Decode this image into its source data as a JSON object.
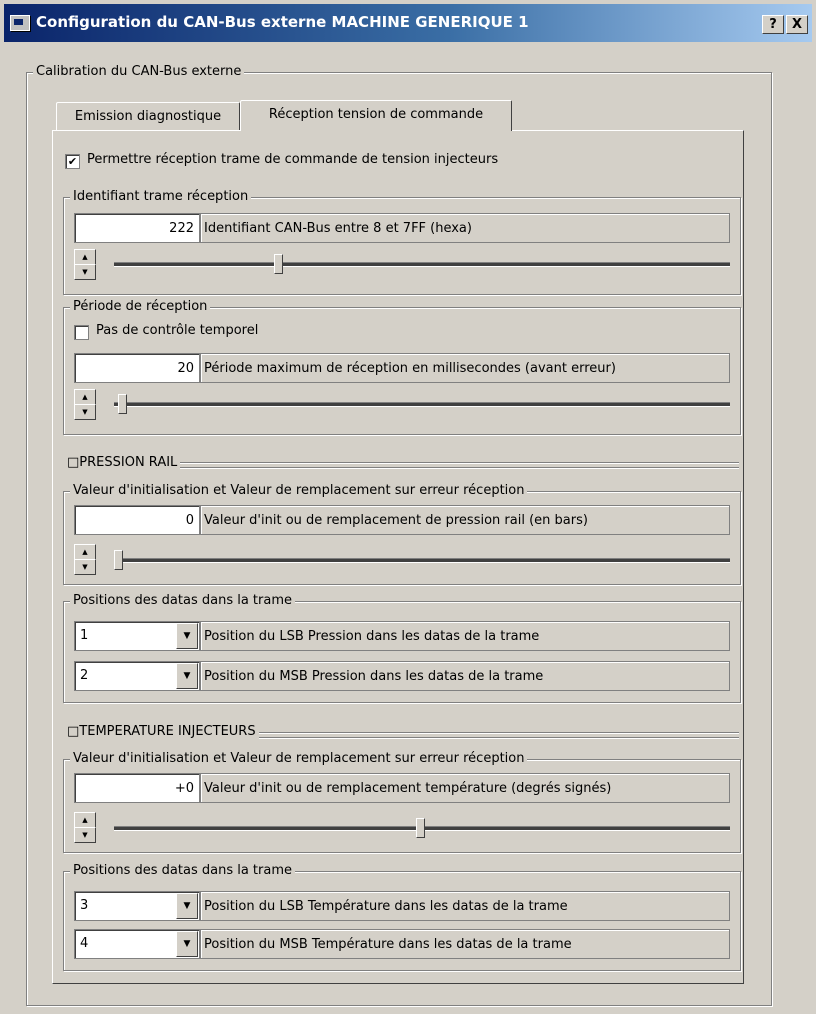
{
  "window": {
    "title": "Configuration du CAN-Bus externe MACHINE GENERIQUE 1",
    "help_label": "?",
    "close_label": "X"
  },
  "calibration": {
    "legend": "Calibration du CAN-Bus externe",
    "tabs": [
      {
        "label": "Emission diagnostique",
        "active": false
      },
      {
        "label": "Réception tension de commande",
        "active": true
      }
    ]
  },
  "reception": {
    "enable_label": "Permettre réception trame de commande de tension injecteurs",
    "enable_checked": true,
    "identifiant": {
      "legend": "Identifiant trame réception",
      "value": "222",
      "description": "Identifiant CAN-Bus entre 8 et 7FF (hexa)",
      "slider_level": 0.27
    },
    "periode": {
      "legend": "Période de réception",
      "no_time_check_label": "Pas de contrôle temporel",
      "no_time_check_checked": false,
      "value": "20",
      "description": "Période maximum de réception en millisecondes (avant erreur)",
      "slider_level": 0.01
    },
    "pression": {
      "title": "PRESSION RAIL",
      "init_legend": "Valeur d'initialisation et Valeur de remplacement sur erreur réception",
      "value": "0",
      "description": "Valeur d'init ou de remplacement de pression rail (en bars)",
      "slider_level": 0.0,
      "positions_legend": "Positions des datas dans la trame",
      "lsb_value": "1",
      "lsb_description": "Position du LSB Pression dans les datas de la trame",
      "msb_value": "2",
      "msb_description": "Position du MSB Pression dans les datas de la trame"
    },
    "temperature": {
      "title": "TEMPERATURE INJECTEURS",
      "init_legend": "Valeur d'initialisation et Valeur de remplacement sur erreur réception",
      "value": "+0",
      "description": "Valeur d'init ou de remplacement température (degrés signés)",
      "slider_level": 0.5,
      "positions_legend": "Positions des datas dans la trame",
      "lsb_value": "3",
      "lsb_description": "Position du LSB Température dans les datas de la trame",
      "msb_value": "4",
      "msb_description": "Position du MSB Température dans les datas de la trame"
    }
  }
}
